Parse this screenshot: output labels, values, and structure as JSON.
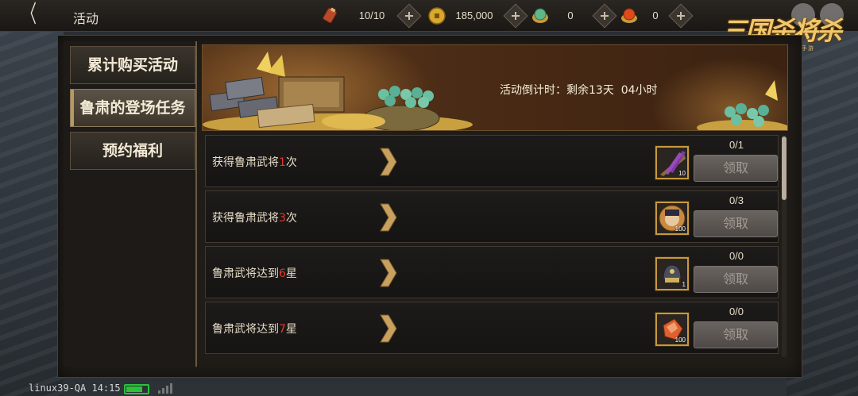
{
  "header": {
    "back_glyph": "〈",
    "title": "活动",
    "resources": [
      {
        "icon": "scroll-icon",
        "value": "10/10"
      },
      {
        "icon": "coin-icon",
        "value": "185,000"
      },
      {
        "icon": "jade-icon",
        "value": "0"
      },
      {
        "icon": "gold-ingot-icon",
        "value": "0"
      }
    ],
    "logo_text": "三国杀将杀",
    "logo_sub": "国战三国无双动作手游"
  },
  "sidebar": {
    "tabs": [
      {
        "label": "累计购买活动",
        "active": false
      },
      {
        "label": "鲁肃的登场任务",
        "active": true
      },
      {
        "label": "预约福利",
        "active": false
      }
    ]
  },
  "banner": {
    "countdown_label": "活动倒计时：",
    "countdown_value": "剩余13天  04小时"
  },
  "tasks": [
    {
      "prefix": "获得鲁肃武将",
      "num": "1",
      "suffix": "次",
      "progress": "0/1",
      "reward_icon": "arrow-bundle-icon",
      "reward_qty": "10",
      "claim_label": "领取"
    },
    {
      "prefix": "获得鲁肃武将",
      "num": "3",
      "suffix": "次",
      "progress": "0/3",
      "reward_icon": "general-portrait-icon",
      "reward_qty": "100",
      "claim_label": "领取"
    },
    {
      "prefix": "鲁肃武将达到",
      "num": "6",
      "suffix": "星",
      "progress": "0/0",
      "reward_icon": "helmet-icon",
      "reward_qty": "1",
      "claim_label": "领取"
    },
    {
      "prefix": "鲁肃武将达到",
      "num": "7",
      "suffix": "星",
      "progress": "0/0",
      "reward_icon": "red-gem-icon",
      "reward_qty": "100",
      "claim_label": "领取"
    }
  ],
  "statusbar": {
    "text": "linux39-QA 14:15"
  },
  "colors": {
    "highlight_number": "#e03a2a",
    "item_border": "#c69a3c",
    "battery": "#2bc23a"
  }
}
